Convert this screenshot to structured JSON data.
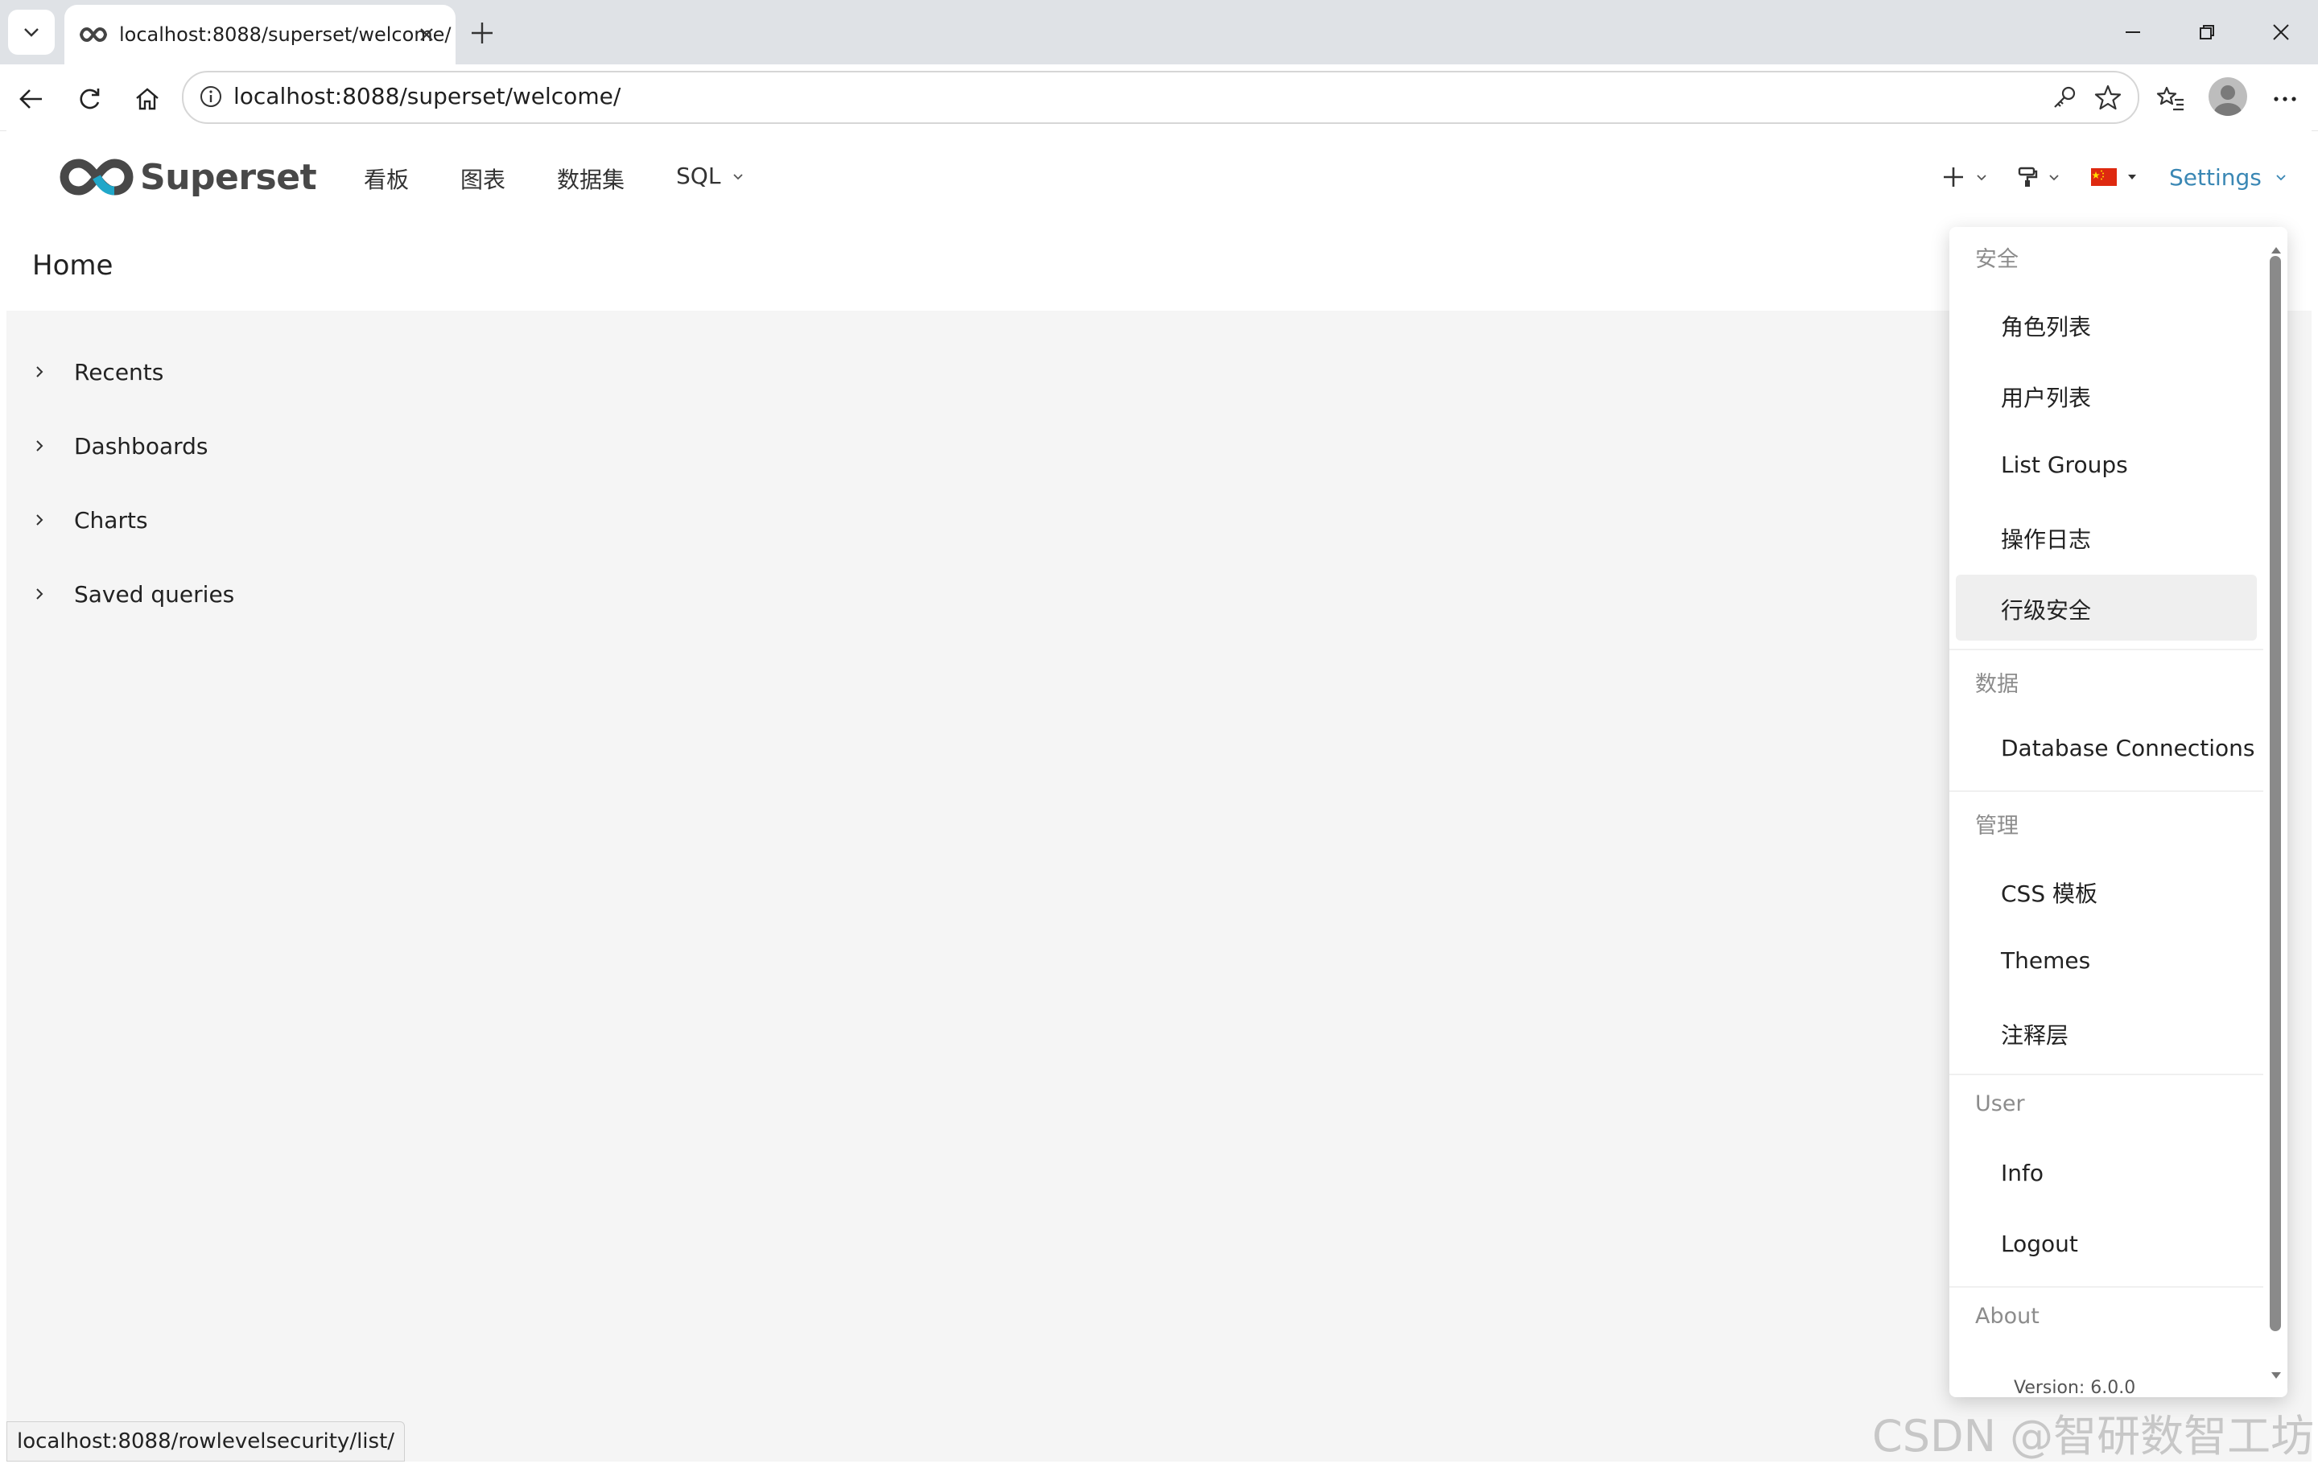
{
  "browser": {
    "tab_title": "localhost:8088/superset/welcome/",
    "url": "localhost:8088/superset/welcome/"
  },
  "app": {
    "brand": "Superset",
    "menu": [
      {
        "label": "看板"
      },
      {
        "label": "图表"
      },
      {
        "label": "数据集"
      },
      {
        "label": "SQL"
      }
    ],
    "settings_label": "Settings",
    "page_title": "Home",
    "sections": [
      {
        "label": "Recents"
      },
      {
        "label": "Dashboards"
      },
      {
        "label": "Charts"
      },
      {
        "label": "Saved queries"
      }
    ]
  },
  "settings_menu": {
    "security": {
      "title": "安全",
      "items": [
        "角色列表",
        "用户列表",
        "List Groups",
        "操作日志",
        "行级安全"
      ],
      "active_item": "行级安全"
    },
    "data": {
      "title": "数据",
      "items": [
        "Database Connections"
      ]
    },
    "manage": {
      "title": "管理",
      "items": [
        "CSS 模板",
        "Themes",
        "注释层"
      ]
    },
    "user": {
      "title": "User",
      "items": [
        "Info",
        "Logout"
      ]
    },
    "about": {
      "title": "About",
      "version": "Version: 6.0.0"
    }
  },
  "status_bar": "localhost:8088/rowlevelsecurity/list/",
  "watermark": "CSDN @智研数智工坊",
  "colors": {
    "accent": "#3a87b4",
    "logo_dark": "#484848",
    "logo_blue": "#20a7c9"
  }
}
